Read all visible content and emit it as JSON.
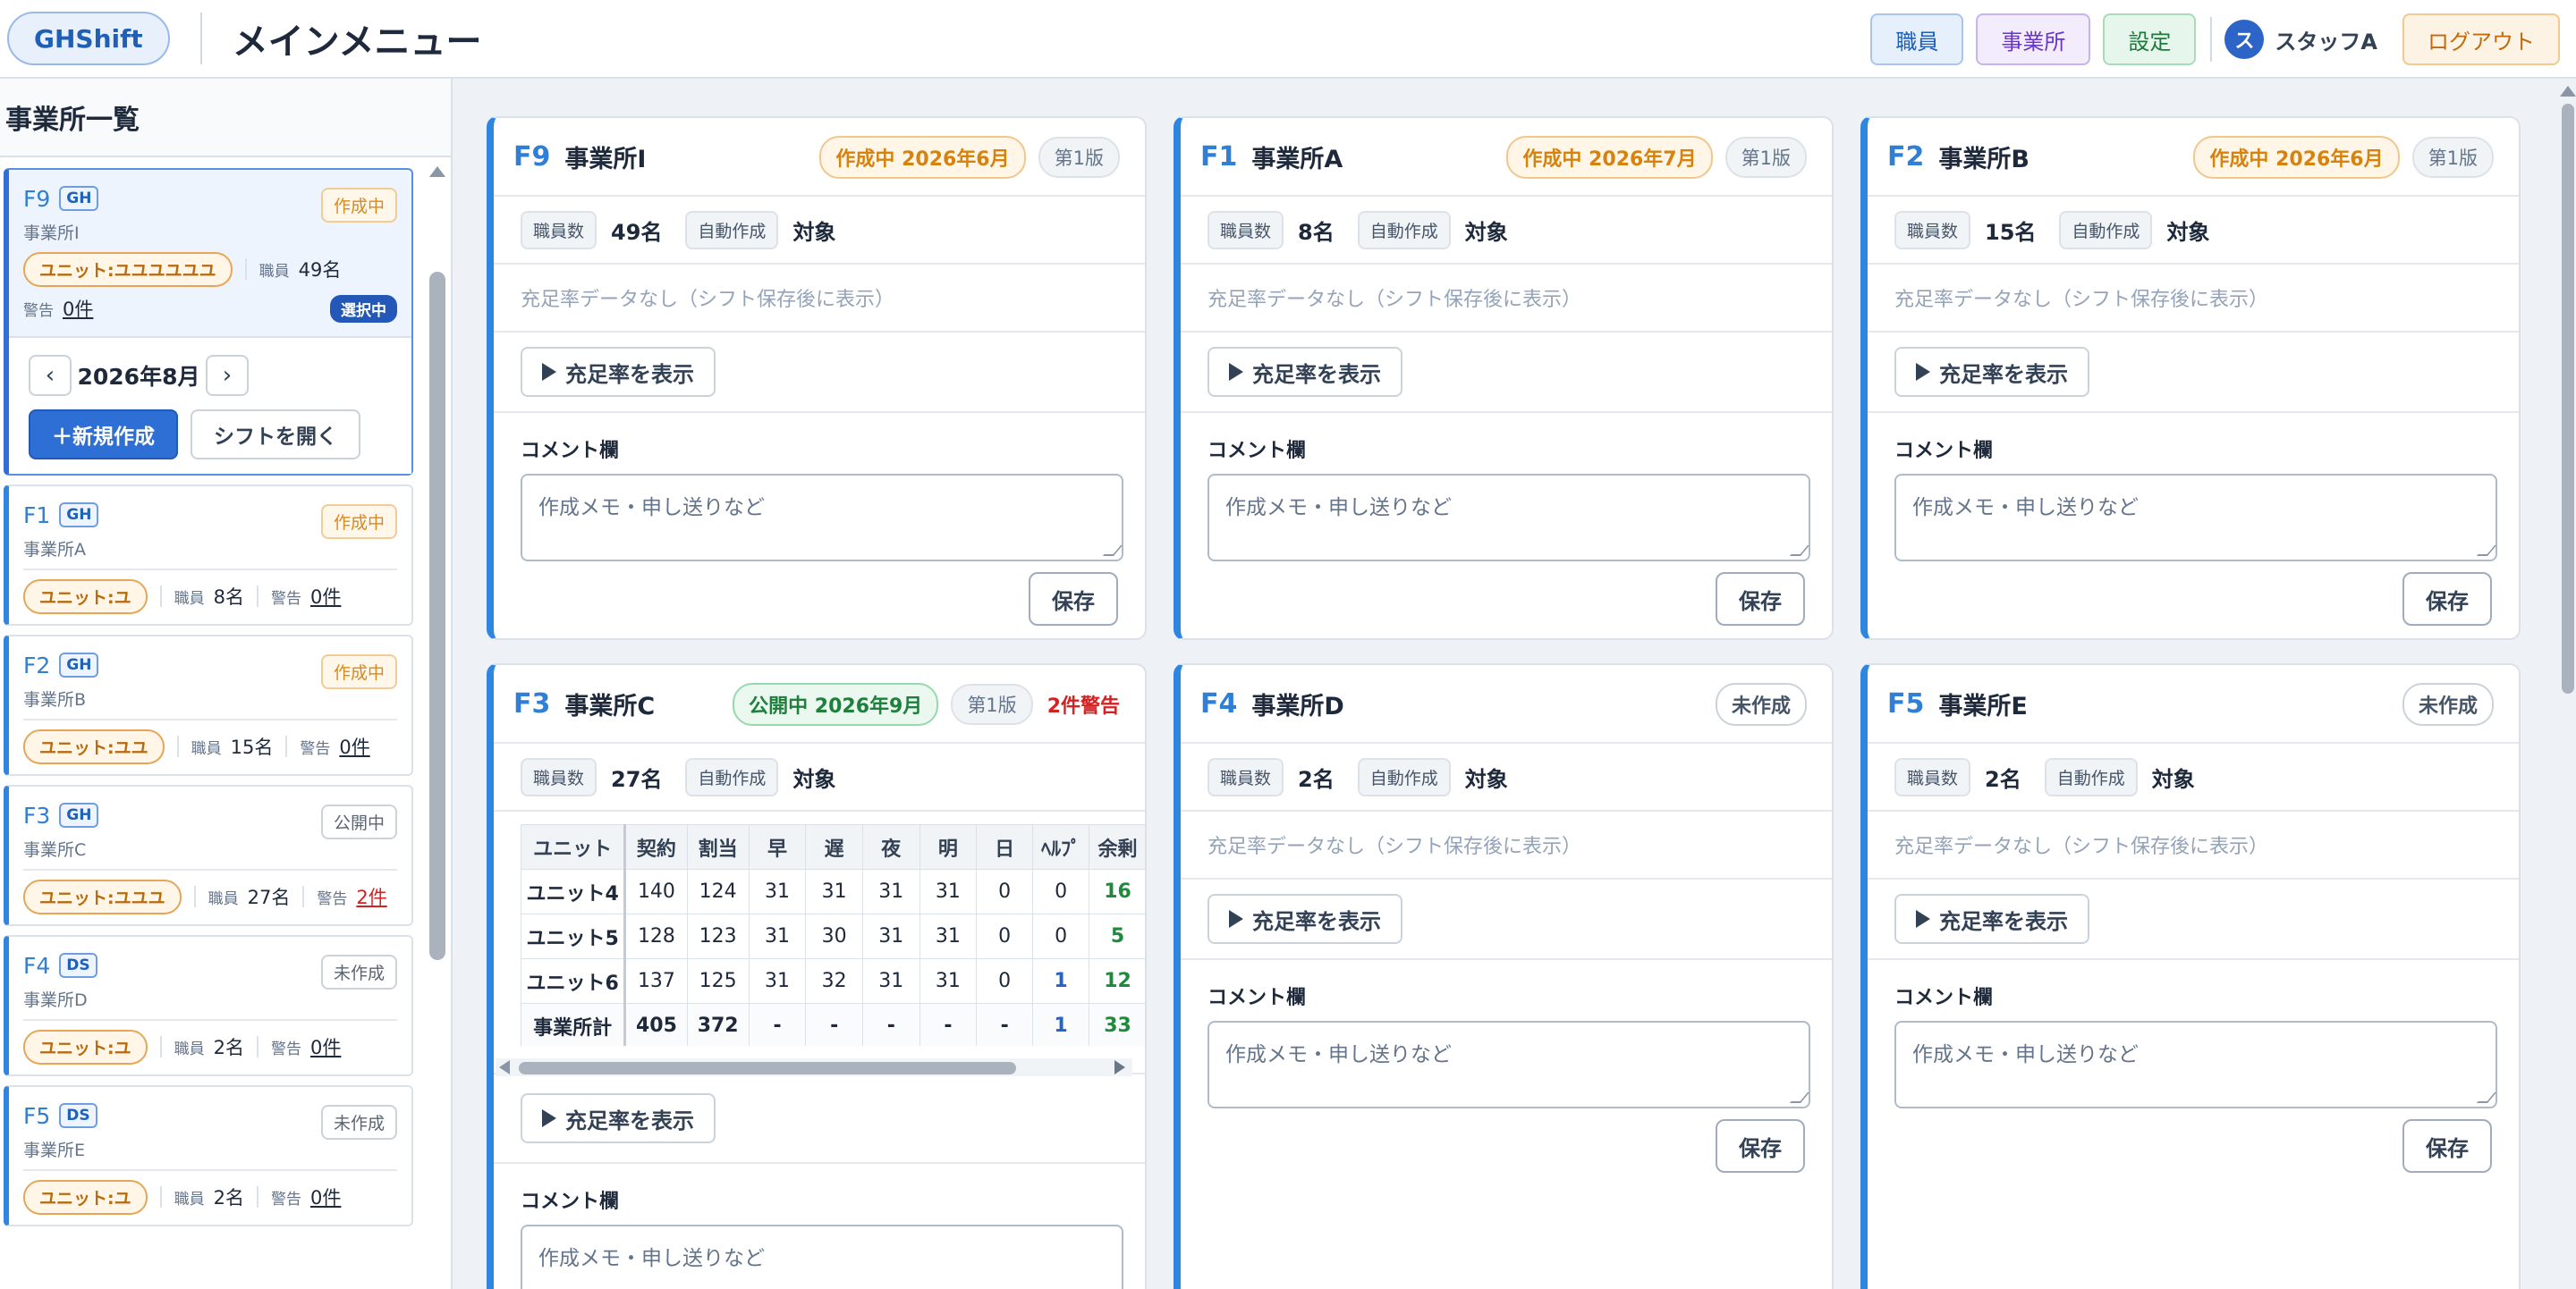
{
  "header": {
    "logo": "GHShift",
    "title": "メインメニュー",
    "nav": {
      "staff": "職員",
      "office": "事業所",
      "settings": "設定"
    },
    "user": {
      "initial": "ス",
      "name": "スタッフA"
    },
    "logout": "ログアウト"
  },
  "sidebar": {
    "title": "事業所一覧",
    "selected": {
      "code": "F9",
      "type": "GH",
      "name": "事業所I",
      "status": "作成中",
      "unit": "ユニット:ユユユユユユ",
      "staff_label": "職員",
      "staff": "49名",
      "warn_label": "警告",
      "warn": "0件",
      "selected_badge": "選択中",
      "month": "2026年8月",
      "prev": "‹",
      "next": "›",
      "new_btn": "＋新規作成",
      "open_btn": "シフトを開く"
    },
    "items": [
      {
        "code": "F1",
        "type": "GH",
        "name": "事業所A",
        "status": "作成中",
        "unit": "ユニット:ユ",
        "staff_label": "職員",
        "staff": "8名",
        "warn_label": "警告",
        "warn": "0件"
      },
      {
        "code": "F2",
        "type": "GH",
        "name": "事業所B",
        "status": "作成中",
        "unit": "ユニット:ユユ",
        "staff_label": "職員",
        "staff": "15名",
        "warn_label": "警告",
        "warn": "0件"
      },
      {
        "code": "F3",
        "type": "GH",
        "name": "事業所C",
        "status": "公開中",
        "unit": "ユニット:ユユユ",
        "staff_label": "職員",
        "staff": "27名",
        "warn_label": "警告",
        "warn": "2件"
      },
      {
        "code": "F4",
        "type": "DS",
        "name": "事業所D",
        "status": "未作成",
        "unit": "ユニット:ユ",
        "staff_label": "職員",
        "staff": "2名",
        "warn_label": "警告",
        "warn": "0件"
      },
      {
        "code": "F5",
        "type": "DS",
        "name": "事業所E",
        "status": "未作成",
        "unit": "ユニット:ユ",
        "staff_label": "職員",
        "staff": "2名",
        "warn_label": "警告",
        "warn": "0件"
      }
    ]
  },
  "common": {
    "staff_chip": "職員数",
    "auto_chip": "自動作成",
    "auto_val": "対象",
    "no_data": "充足率データなし（シフト保存後に表示）",
    "fill_btn": "充足率を表示",
    "comment_label": "コメント欄",
    "comment_placeholder": "作成メモ・申し送りなど",
    "save": "保存"
  },
  "cards": [
    {
      "code": "F9",
      "name": "事業所I",
      "status": "作成中 2026年6月",
      "version": "第1版",
      "staff": "49名"
    },
    {
      "code": "F1",
      "name": "事業所A",
      "status": "作成中 2026年7月",
      "version": "第1版",
      "staff": "8名"
    },
    {
      "code": "F2",
      "name": "事業所B",
      "status": "作成中 2026年6月",
      "version": "第1版",
      "staff": "15名"
    },
    {
      "code": "F3",
      "name": "事業所C",
      "status": "公開中 2026年9月",
      "version": "第1版",
      "warn": "2件警告",
      "staff": "27名"
    },
    {
      "code": "F4",
      "name": "事業所D",
      "status": "未作成",
      "staff": "2名"
    },
    {
      "code": "F5",
      "name": "事業所E",
      "status": "未作成",
      "staff": "2名"
    }
  ],
  "f3_table": {
    "headers": [
      "ユニット",
      "契約",
      "割当",
      "早",
      "遅",
      "夜",
      "明",
      "日",
      "ﾍﾙﾌﾟ",
      "余剰"
    ],
    "rows": [
      [
        "ユニット4",
        "140",
        "124",
        "31",
        "31",
        "31",
        "31",
        "0",
        "0",
        "16"
      ],
      [
        "ユニット5",
        "128",
        "123",
        "31",
        "30",
        "31",
        "31",
        "0",
        "0",
        "5"
      ],
      [
        "ユニット6",
        "137",
        "125",
        "31",
        "32",
        "31",
        "31",
        "0",
        "1",
        "12"
      ],
      [
        "事業所計",
        "405",
        "372",
        "-",
        "-",
        "-",
        "-",
        "-",
        "1",
        "33"
      ]
    ]
  },
  "colors": {
    "accent": "#2f86e0",
    "primary": "#2e6fd6",
    "draft": "#d6820f",
    "published": "#1f7f3c",
    "warning": "#d32222"
  }
}
